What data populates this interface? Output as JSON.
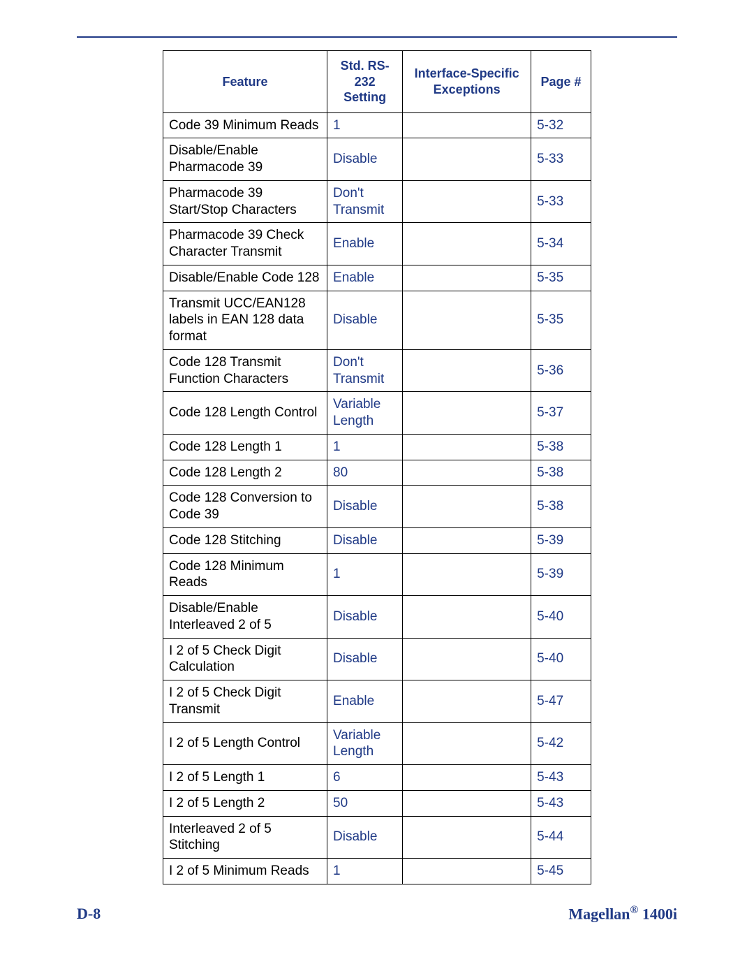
{
  "table": {
    "headers": {
      "feature": "Feature",
      "setting": "Std. RS-232 Setting",
      "exceptions": "Interface-Specific Exceptions",
      "page": "Page #"
    },
    "rows": [
      {
        "feature": "Code 39 Minimum Reads",
        "setting": "1",
        "exceptions": "",
        "page": "5-32"
      },
      {
        "feature": "Disable/Enable Pharmacode 39",
        "setting": "Disable",
        "exceptions": "",
        "page": "5-33"
      },
      {
        "feature": "Pharmacode 39 Start/Stop Characters",
        "setting": "Don't Transmit",
        "exceptions": "",
        "page": "5-33"
      },
      {
        "feature": "Pharmacode 39 Check Character Transmit",
        "setting": "Enable",
        "exceptions": "",
        "page": "5-34"
      },
      {
        "feature": "Disable/Enable Code 128",
        "setting": "Enable",
        "exceptions": "",
        "page": "5-35"
      },
      {
        "feature": "Transmit UCC/EAN128 labels in EAN 128 data format",
        "setting": "Disable",
        "exceptions": "",
        "page": "5-35"
      },
      {
        "feature": "Code 128 Transmit Function Characters",
        "setting": "Don't Transmit",
        "exceptions": "",
        "page": "5-36"
      },
      {
        "feature": "Code 128 Length Control",
        "setting": "Variable Length",
        "exceptions": "",
        "page": "5-37"
      },
      {
        "feature": "Code 128 Length 1",
        "setting": "1",
        "exceptions": "",
        "page": "5-38"
      },
      {
        "feature": "Code 128 Length 2",
        "setting": "80",
        "exceptions": "",
        "page": "5-38"
      },
      {
        "feature": "Code 128 Conversion to Code 39",
        "setting": "Disable",
        "exceptions": "",
        "page": "5-38"
      },
      {
        "feature": "Code 128 Stitching",
        "setting": "Disable",
        "exceptions": "",
        "page": "5-39"
      },
      {
        "feature": "Code 128 Minimum Reads",
        "setting": "1",
        "exceptions": "",
        "page": "5-39"
      },
      {
        "feature": "Disable/Enable Interleaved 2 of 5",
        "setting": "Disable",
        "exceptions": "",
        "page": "5-40"
      },
      {
        "feature": "I 2 of 5 Check Digit Calculation",
        "setting": "Disable",
        "exceptions": "",
        "page": "5-40"
      },
      {
        "feature": "I 2 of 5 Check Digit Transmit",
        "setting": "Enable",
        "exceptions": "",
        "page": "5-47"
      },
      {
        "feature": "I 2 of 5 Length Control",
        "setting": "Variable Length",
        "exceptions": "",
        "page": "5-42"
      },
      {
        "feature": "I 2 of 5 Length 1",
        "setting": "6",
        "exceptions": "",
        "page": "5-43"
      },
      {
        "feature": "I 2 of 5 Length 2",
        "setting": "50",
        "exceptions": "",
        "page": "5-43"
      },
      {
        "feature": "Interleaved 2 of 5 Stitching",
        "setting": "Disable",
        "exceptions": "",
        "page": "5-44"
      },
      {
        "feature": "I 2 of 5 Minimum Reads",
        "setting": "1",
        "exceptions": "",
        "page": "5-45"
      }
    ]
  },
  "footer": {
    "left": "D-8",
    "right_prefix": "Magellan",
    "right_reg": "®",
    "right_suffix": " 1400i"
  }
}
